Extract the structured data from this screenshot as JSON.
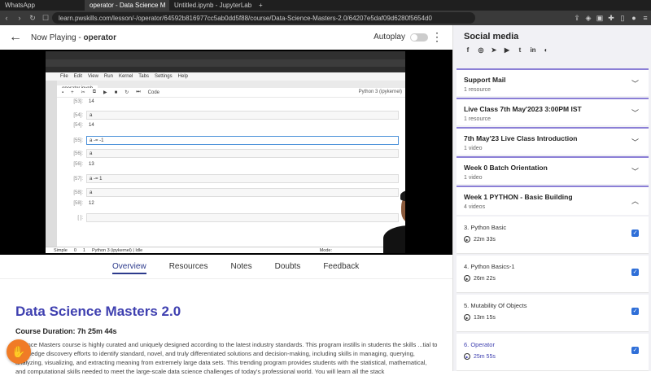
{
  "browser": {
    "tabs": [
      {
        "label": "WhatsApp",
        "active": false
      },
      {
        "label": "operator - Data Science M",
        "active": true
      },
      {
        "label": "Untitled.ipynb - JupyterLab",
        "active": false
      }
    ],
    "url": "learn.pwskills.com/lesson/-/operator/64592b816977cc5ab0dd5f88/course/Data-Science-Masters-2.0/64207e5daf09d6280f5654d0"
  },
  "header": {
    "now_playing_label": "Now Playing -",
    "now_playing_title": "operator",
    "autoplay_label": "Autoplay"
  },
  "video": {
    "notebook_tab": "operator.ipynb",
    "menu": [
      "File",
      "Edit",
      "View",
      "Run",
      "Kernel",
      "Tabs",
      "Settings",
      "Help"
    ],
    "cell_type": "Code",
    "kernel": "Python 3 (ipykernel)",
    "cells": [
      {
        "prompt": "[53]:",
        "text": "14",
        "kind": "out"
      },
      {
        "prompt": "[54]:",
        "text": "a",
        "kind": "in"
      },
      {
        "prompt": "[54]:",
        "text": "14",
        "kind": "out"
      },
      {
        "prompt": "[55]:",
        "text": "a -= -1",
        "kind": "sel"
      },
      {
        "prompt": "[56]:",
        "text": "a",
        "kind": "in"
      },
      {
        "prompt": "[56]:",
        "text": "13",
        "kind": "out"
      },
      {
        "prompt": "[57]:",
        "text": "a -= 1",
        "kind": "in"
      },
      {
        "prompt": "[58]:",
        "text": "a",
        "kind": "in"
      },
      {
        "prompt": "[58]:",
        "text": "12",
        "kind": "out"
      },
      {
        "prompt": "[ ]:",
        "text": "",
        "kind": "in"
      }
    ],
    "status_mode": "Simple",
    "status_counts": "0",
    "status_count2": "1",
    "status_kernel": "Python 3 (ipykernel) | Idle",
    "status_right": "Mode:"
  },
  "subtabs": [
    "Overview",
    "Resources",
    "Notes",
    "Doubts",
    "Feedback"
  ],
  "content": {
    "title": "Data Science Masters 2.0",
    "duration": "Course Duration: 7h 25m 44s",
    "description": "Science Masters course is highly curated and uniquely designed according to the latest industry standards. This program instills in students the skills ...tial to knowledge discovery efforts to identify standard, novel, and truly differentiated solutions and decision-making, including skills in managing, querying, analyzing, visualizing, and extracting meaning from extremely large data sets. This trending program provides students with the statistical, mathematical, and computational skills needed to meet the large-scale data science challenges of today's professional world. You will learn all the stack"
  },
  "sidebar": {
    "social_title": "Social media",
    "social_icons": [
      "facebook-icon",
      "instagram-icon",
      "telegram-icon",
      "youtube-icon",
      "twitter-icon",
      "linkedin-icon",
      "discord-icon"
    ],
    "sections": [
      {
        "title": "Support Mail",
        "sub": "1 resource",
        "chevron": "down"
      },
      {
        "title": "Live Class 7th May'2023 3:00PM IST",
        "sub": "1 resource",
        "chevron": "down"
      },
      {
        "title": "7th May'23 Live Class Introduction",
        "sub": "1 video",
        "chevron": "down"
      },
      {
        "title": "Week 0 Batch Orientation",
        "sub": "1 video",
        "chevron": "down"
      },
      {
        "title": "Week 1 PYTHON - Basic Building",
        "sub": "4 videos",
        "chevron": "up"
      }
    ],
    "lessons": [
      {
        "title": "3. Python Basic",
        "duration": "22m 33s",
        "checked": true,
        "current": false
      },
      {
        "title": "4. Python Basics-1",
        "duration": "26m 22s",
        "checked": true,
        "current": false
      },
      {
        "title": "5. Mutability Of Objects",
        "duration": "13m 15s",
        "checked": true,
        "current": false
      },
      {
        "title": "6. Operator",
        "duration": "25m 55s",
        "checked": true,
        "current": true
      }
    ]
  }
}
